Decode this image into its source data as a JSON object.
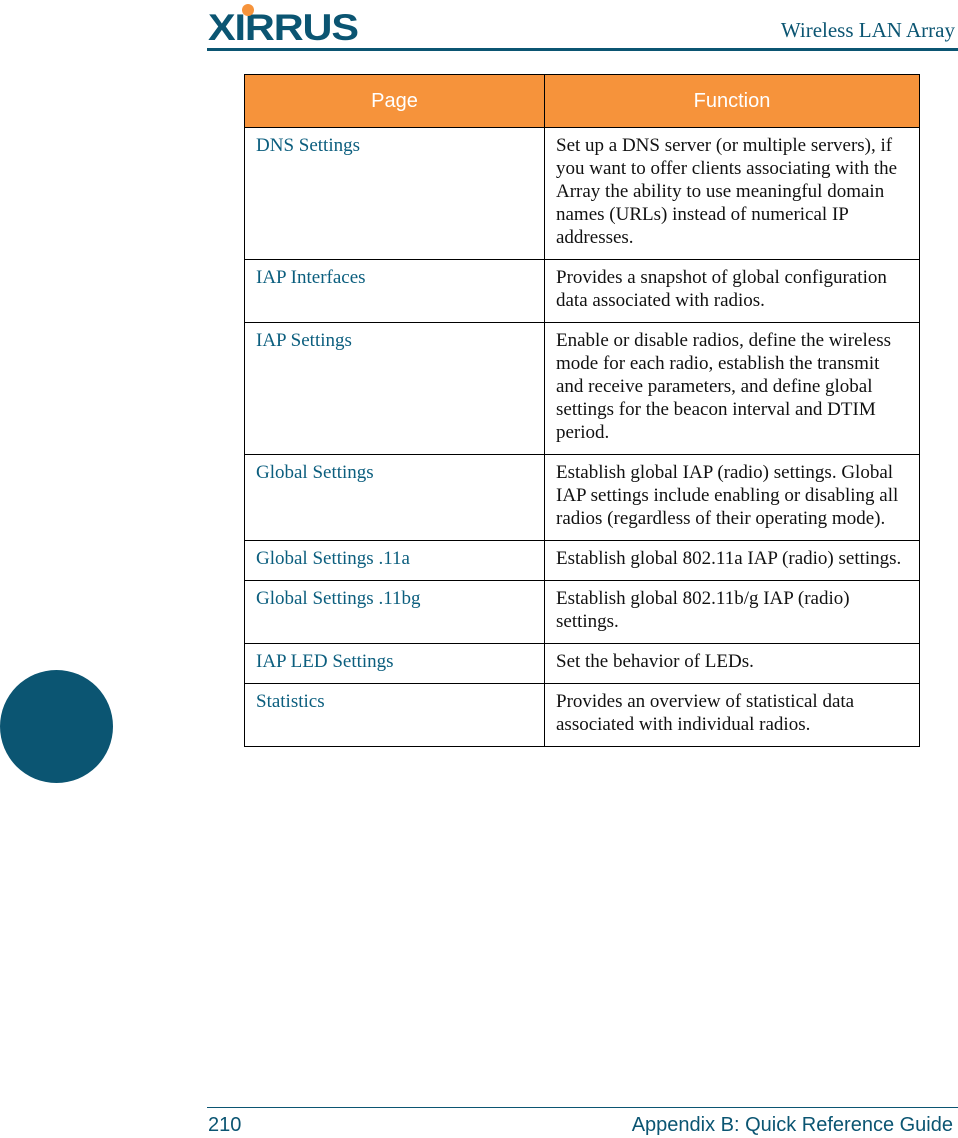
{
  "header": {
    "logo_text": "XIRRUS",
    "doc_title": "Wireless LAN Array"
  },
  "table": {
    "columns": [
      "Page",
      "Function"
    ],
    "rows": [
      {
        "page": "DNS Settings",
        "function": "Set up a DNS server (or multiple servers), if you want to offer clients associating with the Array the ability to use meaningful domain names (URLs) instead of numerical IP addresses."
      },
      {
        "page": "IAP Interfaces",
        "function": "Provides a snapshot of global configuration data associated with radios."
      },
      {
        "page": "IAP Settings",
        "function": "Enable or disable radios, define the wireless mode for each radio, establish the transmit and receive parameters, and define global settings for the beacon interval and DTIM period."
      },
      {
        "page": "Global Settings",
        "function": "Establish global IAP (radio) settings. Global IAP settings include enabling or disabling all radios (regardless of their operating mode)."
      },
      {
        "page": "Global Settings .11a",
        "function": "Establish global 802.11a IAP (radio) settings."
      },
      {
        "page": "Global Settings .11bg",
        "function": "Establish global 802.11b/g IAP (radio) settings."
      },
      {
        "page": "IAP LED Settings",
        "function": "Set the behavior of LEDs."
      },
      {
        "page": "Statistics",
        "function": "Provides an overview of statistical data associated with individual radios."
      }
    ]
  },
  "footer": {
    "page_number": "210",
    "section_title": "Appendix B: Quick Reference Guide"
  },
  "colors": {
    "brand_blue": "#0b5572",
    "header_orange": "#f6933b",
    "link_blue": "#0b5e7e"
  }
}
